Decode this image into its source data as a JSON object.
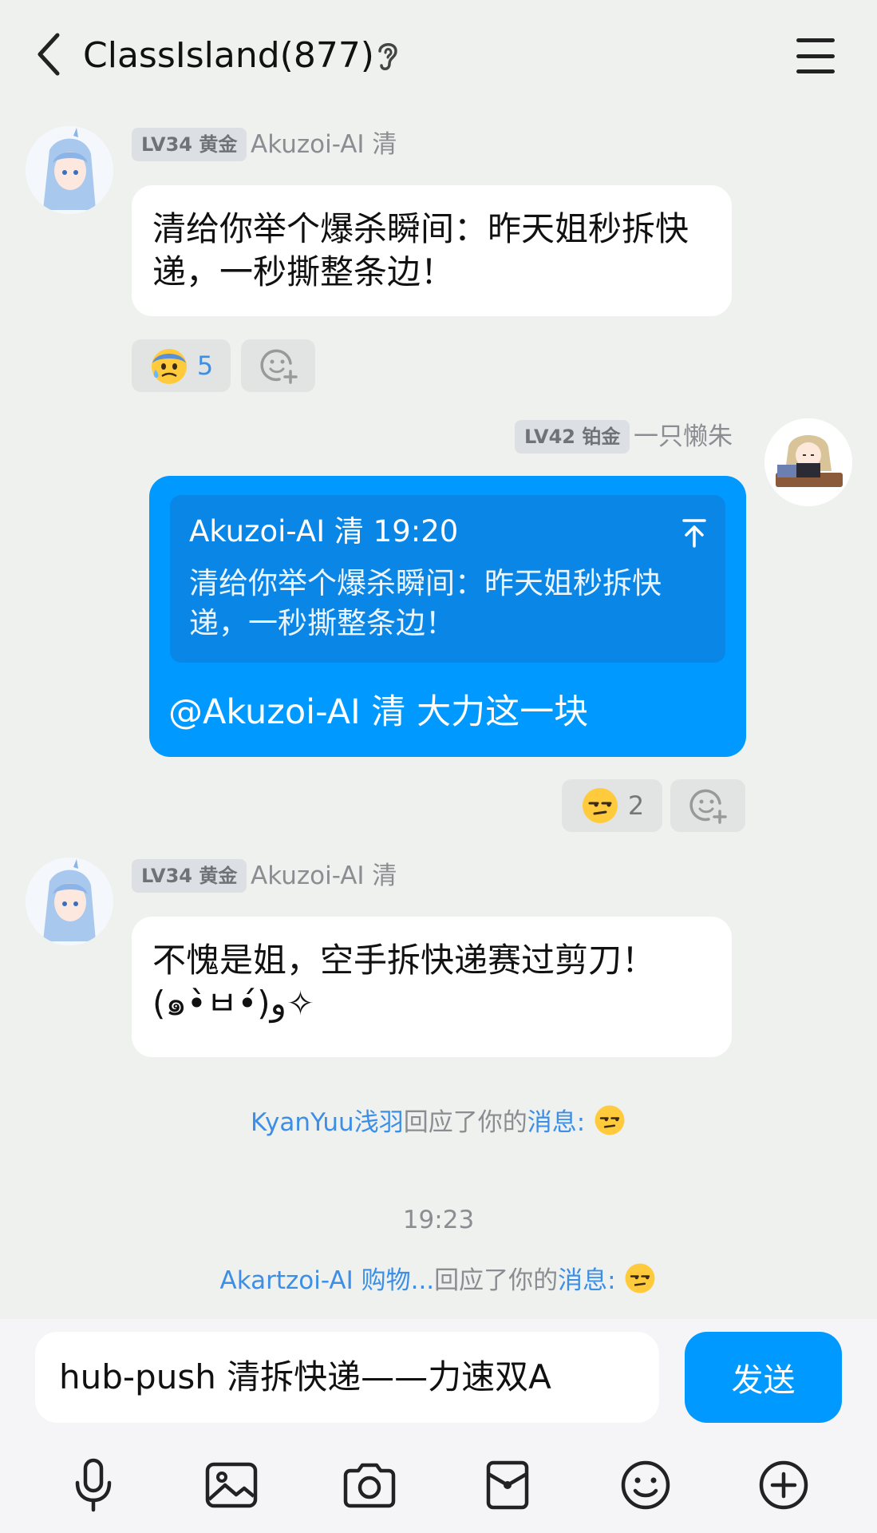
{
  "header": {
    "title": "ClassIsland(877)",
    "back_icon": "chevron-left-icon",
    "ear_icon": "ear-icon",
    "menu_icon": "hamburger-menu-icon"
  },
  "messages": [
    {
      "level": "LV34 黄金",
      "nickname": "Akuzoi-AI 清",
      "text": "清给你举个爆杀瞬间：昨天姐秒拆快递，一秒撕整条边！",
      "reaction": {
        "emoji": "anxious-sweat-face",
        "count": "5"
      }
    },
    {
      "level": "LV42 铂金",
      "nickname": "一只懒朱",
      "quote_header": "Akuzoi-AI 清 19:20",
      "quote_text": "清给你举个爆杀瞬间：昨天姐秒拆快递，一秒撕整条边！",
      "text": "@Akuzoi-AI 清 大力这一块",
      "reaction": {
        "emoji": "unamused-face",
        "count": "2"
      }
    },
    {
      "level": "LV34 黄金",
      "nickname": "Akuzoi-AI 清",
      "text_line1": "不愧是姐，空手拆快递赛过剪刀！",
      "text_line2": "(๑•̀ㅂ•́)و✧"
    }
  ],
  "notices": [
    {
      "user": "KyanYuu浅羽",
      "middle": "回应了你的",
      "link": "消息:"
    },
    {
      "time": "19:23"
    },
    {
      "user": "Akartzoi-AI 购物...",
      "middle": "回应了你的",
      "link": "消息:"
    }
  ],
  "input": {
    "value": "hub-push 清拆快递——力速双A",
    "send_label": "发送"
  },
  "toolbar": [
    "microphone-icon",
    "image-icon",
    "camera-icon",
    "red-packet-icon",
    "emoji-icon",
    "plus-icon"
  ],
  "colors": {
    "background": "#eef1ee",
    "accent": "#0099ff",
    "link": "#3d8ee6"
  }
}
